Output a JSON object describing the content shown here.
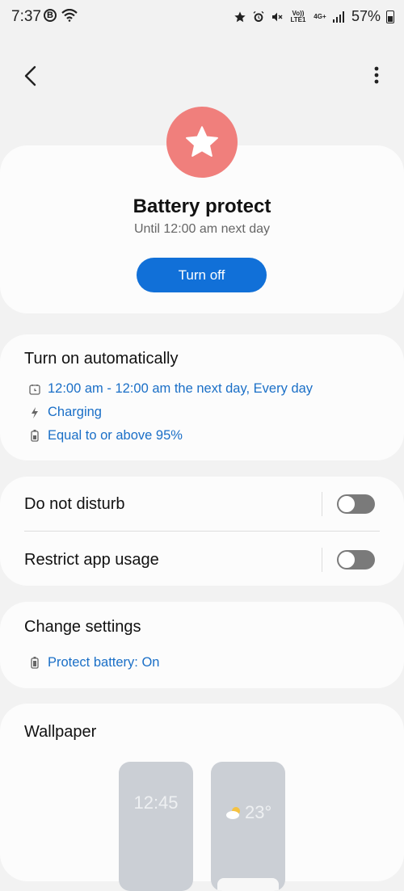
{
  "status_bar": {
    "time": "7:37",
    "b_badge": "B",
    "volte": "Vo)) LTE1",
    "network": "4G+",
    "battery_percent": "57%"
  },
  "nav": {
    "back_icon": "chevron-left-icon",
    "more_icon": "more-vertical-icon"
  },
  "hero": {
    "icon": "star-icon",
    "icon_bg": "#f07f7c",
    "title": "Battery protect",
    "subtitle": "Until 12:00 am next day",
    "button_label": "Turn off",
    "button_color": "#1170d8"
  },
  "auto": {
    "title": "Turn on automatically",
    "conditions": [
      {
        "icon": "calendar-clock-icon",
        "text": "12:00 am - 12:00 am the next day, Every day"
      },
      {
        "icon": "charging-bolt-icon",
        "text": "Charging"
      },
      {
        "icon": "battery-icon",
        "text": "Equal to or above 95%"
      }
    ],
    "link_color": "#1a6fc7"
  },
  "toggles": [
    {
      "label": "Do not disturb",
      "state": "off"
    },
    {
      "label": "Restrict app usage",
      "state": "off"
    }
  ],
  "change_settings": {
    "title": "Change settings",
    "items": [
      {
        "icon": "battery-protect-icon",
        "text": "Protect battery: On"
      }
    ]
  },
  "wallpaper": {
    "title": "Wallpaper",
    "lock_clock": "12:45",
    "weather_temp": "23°"
  }
}
